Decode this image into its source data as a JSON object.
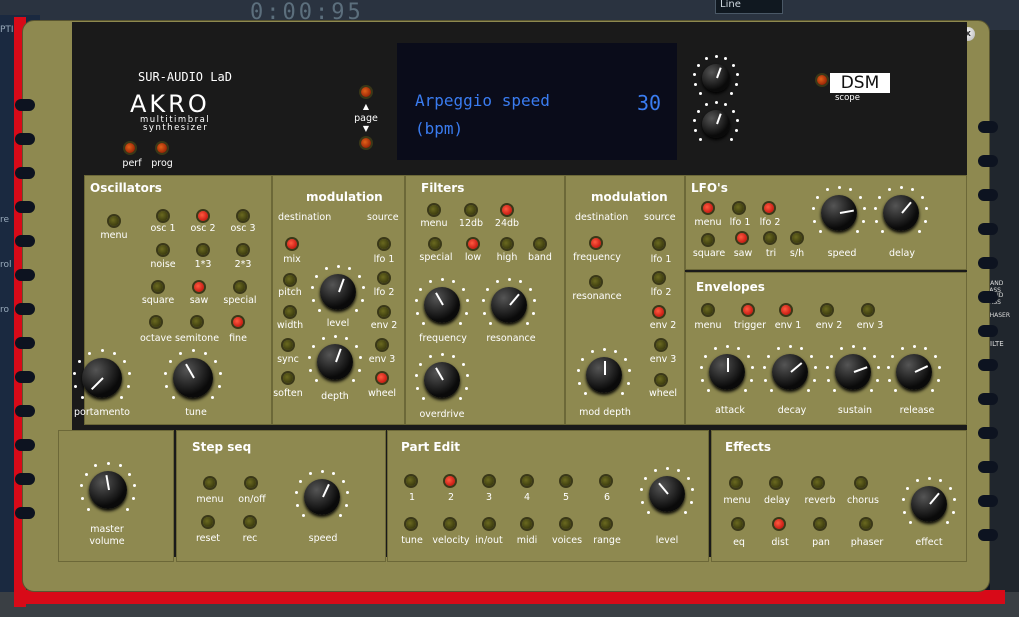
{
  "host": {
    "clock": "0:00:95",
    "line_select": "Line",
    "left_labels": [
      "PTIO",
      "re",
      "rol",
      "ro"
    ],
    "right_labels": [
      "BAND PASS",
      "BAND PASS",
      "PHASER",
      "ILTE"
    ]
  },
  "window": {
    "minimize": "–",
    "close": "x"
  },
  "brand": {
    "maker": "SUR-AUDIO LaD",
    "model": "AKRO",
    "line1": "multitimbral",
    "line2": "synthesizer",
    "perf": "perf",
    "prog": "prog",
    "page": "page",
    "scope": "scope",
    "dsm": "DSM"
  },
  "display": {
    "line1": "Arpeggio speed",
    "line2": "(bpm)",
    "value": "30"
  },
  "oscillators": {
    "title": "Oscillators",
    "menu": "menu",
    "osc1": "osc 1",
    "osc2": "osc 2",
    "osc3": "osc 3",
    "noise": "noise",
    "r13": "1*3",
    "r23": "2*3",
    "square": "square",
    "saw": "saw",
    "special": "special",
    "octave": "octave",
    "semitone": "semitone",
    "fine": "fine",
    "portamento": "portamento",
    "tune": "tune"
  },
  "modulation1": {
    "title": "modulation",
    "destination": "destination",
    "source": "source",
    "mix": "mix",
    "pitch": "pitch",
    "width": "width",
    "sync": "sync",
    "soften": "soften",
    "level": "level",
    "depth": "depth",
    "lfo1": "lfo 1",
    "lfo2": "lfo 2",
    "env2": "env 2",
    "env3": "env 3",
    "wheel": "wheel"
  },
  "filters": {
    "title": "Filters",
    "menu": "menu",
    "db12": "12db",
    "db24": "24db",
    "special": "special",
    "low": "low",
    "high": "high",
    "band": "band",
    "frequency": "frequency",
    "resonance": "resonance",
    "overdrive": "overdrive"
  },
  "modulation2": {
    "title": "modulation",
    "destination": "destination",
    "source": "source",
    "frequency": "frequency",
    "resonance": "resonance",
    "lfo1": "lfo 1",
    "lfo2": "lfo 2",
    "env2": "env 2",
    "env3": "env 3",
    "wheel": "wheel",
    "mod_depth": "mod depth"
  },
  "lfos": {
    "title": "LFO's",
    "menu": "menu",
    "lfo1": "lfo 1",
    "lfo2": "lfo 2",
    "square": "square",
    "saw": "saw",
    "tri": "tri",
    "sh": "s/h",
    "speed": "speed",
    "delay": "delay"
  },
  "envelopes": {
    "title": "Envelopes",
    "menu": "menu",
    "trigger": "trigger",
    "env1": "env 1",
    "env2": "env 2",
    "env3": "env 3",
    "attack": "attack",
    "decay": "decay",
    "sustain": "sustain",
    "release": "release"
  },
  "master": {
    "label1": "master",
    "label2": "volume"
  },
  "stepseq": {
    "title": "Step seq",
    "menu": "menu",
    "onoff": "on/off",
    "reset": "reset",
    "rec": "rec",
    "speed": "speed"
  },
  "partedit": {
    "title": "Part Edit",
    "p1": "1",
    "p2": "2",
    "p3": "3",
    "p4": "4",
    "p5": "5",
    "p6": "6",
    "tune": "tune",
    "velocity": "velocity",
    "inout": "in/out",
    "midi": "midi",
    "voices": "voices",
    "range": "range",
    "level": "level"
  },
  "effects": {
    "title": "Effects",
    "menu": "menu",
    "delay": "delay",
    "reverb": "reverb",
    "chorus": "chorus",
    "eq": "eq",
    "dist": "dist",
    "pan": "pan",
    "phaser": "phaser",
    "effect": "effect"
  },
  "colors": {
    "body": "#8e8950",
    "led_on": "#ff3a20",
    "lcd_text": "#3a7cf0"
  }
}
